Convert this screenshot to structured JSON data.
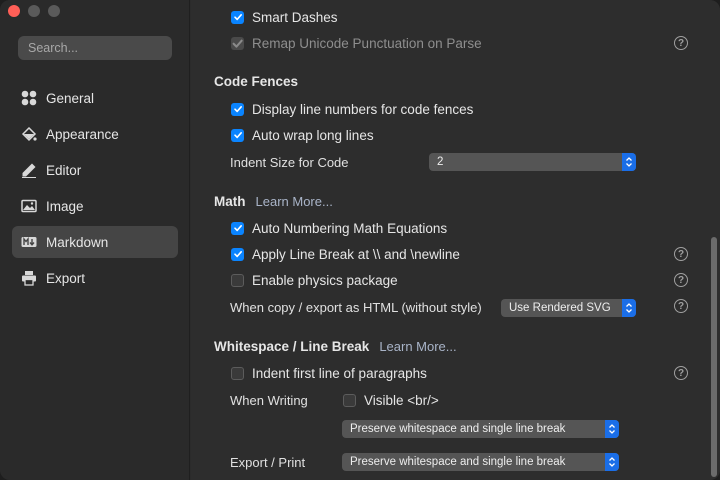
{
  "sidebar": {
    "search_placeholder": "Search...",
    "items": [
      {
        "label": "General",
        "icon": "grid-icon"
      },
      {
        "label": "Appearance",
        "icon": "paint-bucket-icon"
      },
      {
        "label": "Editor",
        "icon": "pencil-icon"
      },
      {
        "label": "Image",
        "icon": "image-icon"
      },
      {
        "label": "Markdown",
        "icon": "markdown-icon",
        "active": true
      },
      {
        "label": "Export",
        "icon": "printer-icon"
      }
    ]
  },
  "main": {
    "smart_dashes": {
      "label": "Smart Dashes",
      "checked": true
    },
    "remap_unicode": {
      "label": "Remap Unicode Punctuation on Parse",
      "checked": true,
      "disabled": true
    },
    "code_fences": {
      "title": "Code Fences",
      "display_line_numbers": {
        "label": "Display line numbers for code fences",
        "checked": true
      },
      "auto_wrap": {
        "label": "Auto wrap long lines",
        "checked": true
      },
      "indent_label": "Indent Size for Code",
      "indent_value": "2"
    },
    "math": {
      "title": "Math",
      "learn_more": "Learn More...",
      "auto_numbering": {
        "label": "Auto Numbering Math Equations",
        "checked": true
      },
      "line_break": {
        "label": "Apply Line Break at \\\\ and \\newline",
        "checked": true
      },
      "physics": {
        "label": "Enable physics package",
        "checked": false
      },
      "copy_export_label": "When copy / export as HTML (without style)",
      "copy_export_value": "Use Rendered SVG"
    },
    "whitespace": {
      "title": "Whitespace / Line Break",
      "learn_more": "Learn More...",
      "indent_first": {
        "label": "Indent first line of paragraphs",
        "checked": false
      },
      "when_writing_label": "When Writing",
      "visible_br": {
        "label": "Visible <br/>",
        "checked": false
      },
      "when_writing_value": "Preserve whitespace and single line break",
      "export_print_label": "Export / Print",
      "export_print_value": "Preserve whitespace and single line break"
    }
  },
  "colors": {
    "accent": "#0a84ff",
    "close_button": "#ff5f57",
    "sidebar_bg": "#2a2a2a",
    "main_bg": "#2d2d2d"
  }
}
